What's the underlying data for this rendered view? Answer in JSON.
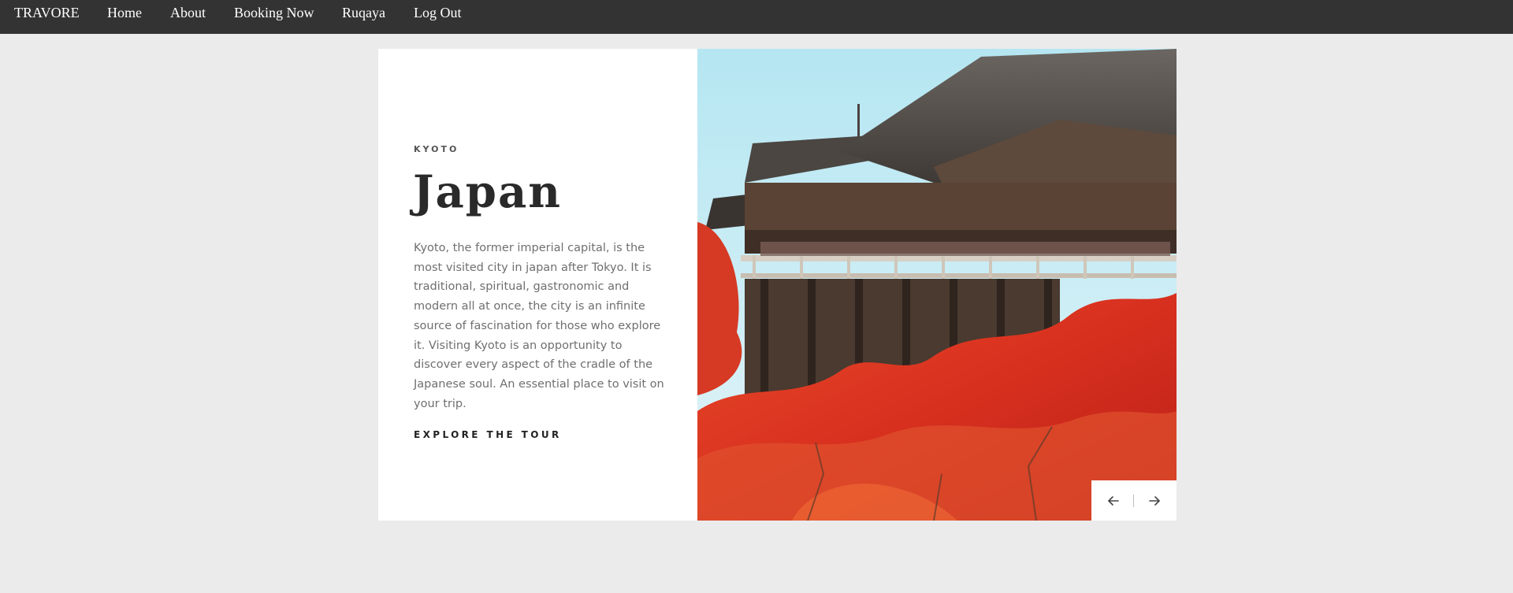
{
  "nav": {
    "brand": "TRAVORE",
    "items": [
      "Home",
      "About",
      "Booking Now",
      "Ruqaya",
      "Log Out"
    ]
  },
  "slide": {
    "eyebrow": "KYOTO",
    "title": "Japan",
    "description": "Kyoto, the former imperial capital, is the most visited city in japan after Tokyo. It is traditional, spiritual, gastronomic and modern all at once, the city is an infinite source of fascination for those who explore it. Visiting Kyoto is an opportunity to discover every aspect of the cradle of the Japanese soul. An essential place to visit on your trip.",
    "cta": "EXPLORE THE TOUR"
  },
  "slider": {
    "prev_icon": "arrow-left-icon",
    "next_icon": "arrow-right-icon"
  },
  "colors": {
    "nav_bg": "#333333",
    "page_bg": "#ebebeb",
    "card_bg": "#ffffff",
    "title": "#2a2a2a",
    "body_text": "#6f6f6f"
  }
}
